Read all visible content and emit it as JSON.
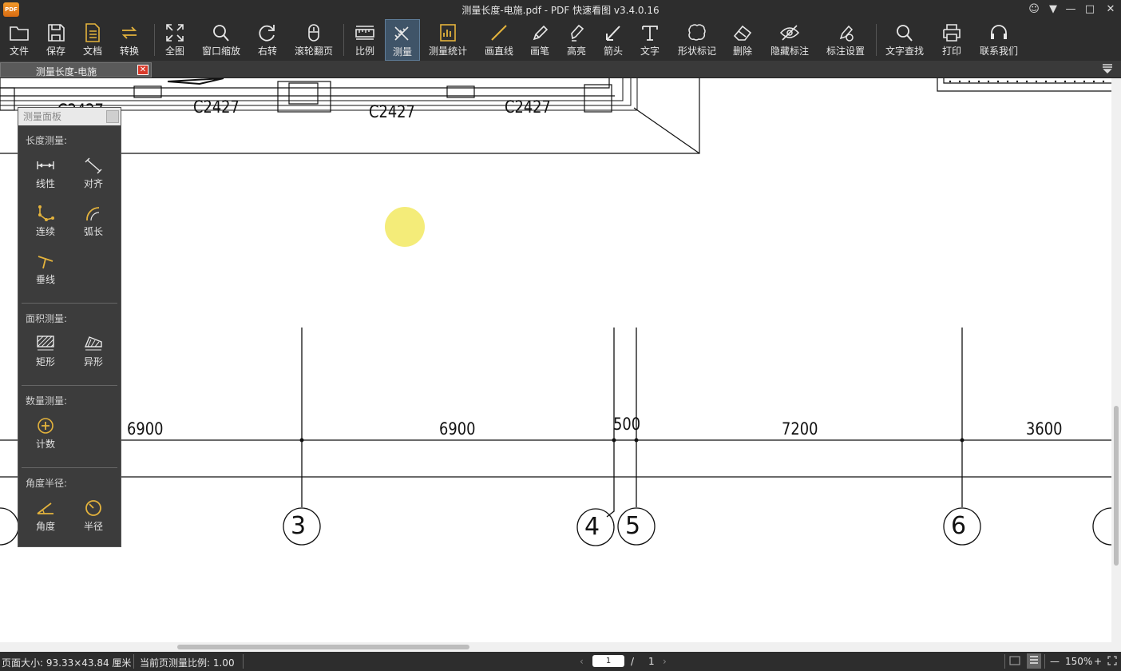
{
  "window": {
    "title": "测量长度-电施.pdf - PDF 快速看图 v3.4.0.16",
    "logo_text": "PDF"
  },
  "toolbar": {
    "items": [
      {
        "label": "文件",
        "icon": "folder-icon"
      },
      {
        "label": "保存",
        "icon": "save-icon"
      },
      {
        "label": "文档",
        "icon": "document-icon"
      },
      {
        "label": "转换",
        "icon": "convert-icon"
      },
      {
        "label": "全图",
        "icon": "fullscreen-icon"
      },
      {
        "label": "窗口缩放",
        "icon": "zoom-window-icon"
      },
      {
        "label": "右转",
        "icon": "rotate-right-icon"
      },
      {
        "label": "滚轮翻页",
        "icon": "mouse-wheel-icon"
      },
      {
        "label": "比例",
        "icon": "scale-icon"
      },
      {
        "label": "测量",
        "icon": "measure-icon"
      },
      {
        "label": "测量统计",
        "icon": "measure-stats-icon"
      },
      {
        "label": "画直线",
        "icon": "line-icon"
      },
      {
        "label": "画笔",
        "icon": "pen-icon"
      },
      {
        "label": "高亮",
        "icon": "highlight-icon"
      },
      {
        "label": "箭头",
        "icon": "arrow-icon"
      },
      {
        "label": "文字",
        "icon": "text-icon"
      },
      {
        "label": "形状标记",
        "icon": "cloud-shape-icon"
      },
      {
        "label": "删除",
        "icon": "eraser-icon"
      },
      {
        "label": "隐藏标注",
        "icon": "hide-eye-icon"
      },
      {
        "label": "标注设置",
        "icon": "annotation-settings-icon"
      },
      {
        "label": "文字查找",
        "icon": "search-icon"
      },
      {
        "label": "打印",
        "icon": "printer-icon"
      },
      {
        "label": "联系我们",
        "icon": "headset-icon"
      }
    ],
    "active": "测量"
  },
  "tab": {
    "label": "测量长度-电施",
    "close": "✕"
  },
  "drawing": {
    "window_labels": [
      "C2427",
      "C2427",
      "C2427",
      "C2427"
    ],
    "dimensions": [
      "6900",
      "6900",
      "500",
      "7200",
      "3600"
    ],
    "axis_numbers": [
      "3",
      "4",
      "5",
      "6"
    ]
  },
  "panel": {
    "title": "测量面板",
    "sections": [
      {
        "title": "长度测量:",
        "tools": [
          {
            "label": "线性",
            "icon": "linear-measure-icon"
          },
          {
            "label": "对齐",
            "icon": "aligned-measure-icon"
          },
          {
            "label": "连续",
            "icon": "continuous-measure-icon"
          },
          {
            "label": "弧长",
            "icon": "arc-length-icon"
          },
          {
            "label": "垂线",
            "icon": "perpendicular-icon"
          }
        ]
      },
      {
        "title": "面积测量:",
        "tools": [
          {
            "label": "矩形",
            "icon": "rectangle-area-icon"
          },
          {
            "label": "异形",
            "icon": "polygon-area-icon"
          }
        ]
      },
      {
        "title": "数量测量:",
        "tools": [
          {
            "label": "计数",
            "icon": "count-icon"
          }
        ]
      },
      {
        "title": "角度半径:",
        "tools": [
          {
            "label": "角度",
            "icon": "angle-icon"
          },
          {
            "label": "半径",
            "icon": "radius-icon"
          }
        ]
      }
    ]
  },
  "status": {
    "page_size": "页面大小: 93.33×43.84 厘米",
    "scale": "当前页测量比例: 1.00",
    "page_current": "1",
    "page_sep": "/",
    "page_total": "1",
    "zoom": "150%",
    "zoom_minus": "—",
    "zoom_plus": "+"
  }
}
